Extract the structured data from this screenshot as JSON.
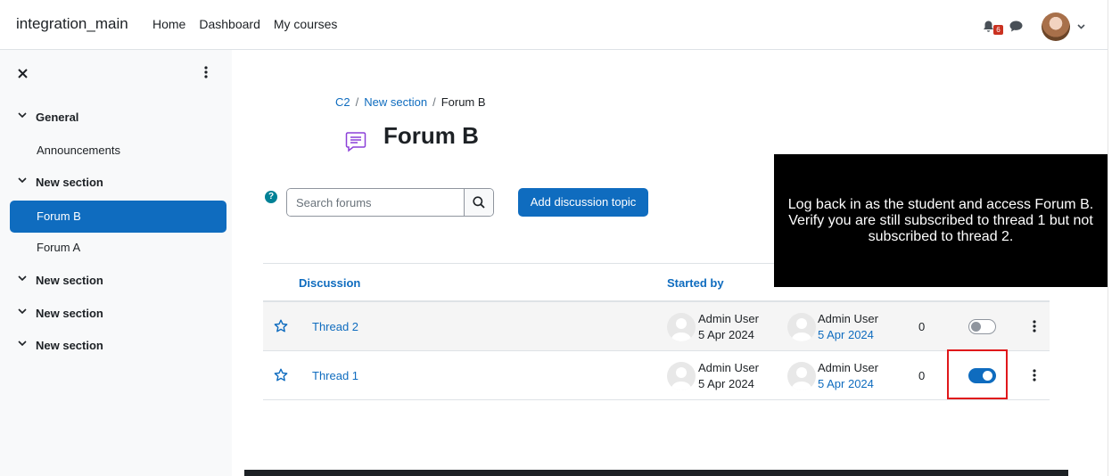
{
  "navbar": {
    "brand": "integration_main",
    "links": [
      "Home",
      "Dashboard",
      "My courses"
    ],
    "notification_count": "6"
  },
  "drawer": {
    "items": [
      {
        "label": "General",
        "type": "section"
      },
      {
        "label": "Announcements",
        "type": "activity"
      },
      {
        "label": "New section",
        "type": "section"
      },
      {
        "label": "Forum B",
        "type": "activity",
        "current": true
      },
      {
        "label": "Forum A",
        "type": "activity"
      },
      {
        "label": "New section",
        "type": "section"
      },
      {
        "label": "New section",
        "type": "section"
      },
      {
        "label": "New section",
        "type": "section"
      }
    ]
  },
  "breadcrumb": [
    "C2",
    "New section",
    "Forum B"
  ],
  "page": {
    "title": "Forum B",
    "search_placeholder": "Search forums",
    "add_button": "Add discussion topic",
    "help_glyph": "?"
  },
  "table": {
    "headers": {
      "discussion": "Discussion",
      "started_by": "Started by"
    },
    "rows": [
      {
        "title": "Thread 2",
        "starter": "Admin User",
        "start_date": "5 Apr 2024",
        "last_user": "Admin User",
        "last_date": "5 Apr 2024",
        "replies": "0",
        "subscribed": false
      },
      {
        "title": "Thread 1",
        "starter": "Admin User",
        "start_date": "5 Apr 2024",
        "last_user": "Admin User",
        "last_date": "5 Apr 2024",
        "replies": "0",
        "subscribed": true
      }
    ]
  },
  "overlay": {
    "text": "Log back in as the student and access Forum B. Verify you are still subscribed to thread 1 but not subscribed to thread 2."
  },
  "colors": {
    "primary": "#0f6cbf",
    "help": "#008196",
    "badge": "#ca3120",
    "highlight": "#e0181b"
  }
}
